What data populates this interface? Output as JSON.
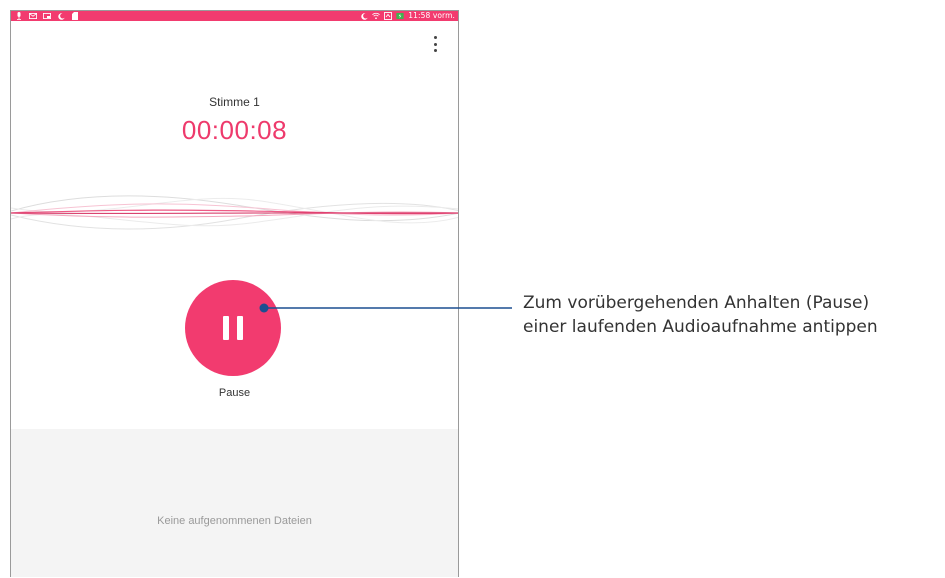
{
  "status_bar": {
    "time": "11:58 vorm.",
    "left_icons": [
      "microphone-icon",
      "mail-icon",
      "cast-icon",
      "moon-icon",
      "sd-card-icon"
    ],
    "right_icons": [
      "moon-icon",
      "wifi-icon",
      "battery-saver-icon",
      "battery-charging-icon"
    ]
  },
  "recording": {
    "name": "Stimme 1",
    "elapsed": "00:00:08"
  },
  "controls": {
    "pause_label": "Pause"
  },
  "files": {
    "empty_message": "Keine aufgenommenen Dateien"
  },
  "callout": {
    "line1": "Zum vorübergehenden Anhalten (Pause)",
    "line2": "einer laufenden Audioaufnahme antippen"
  },
  "colors": {
    "accent": "#f23b6f",
    "callout_line": "#1b4f91"
  }
}
